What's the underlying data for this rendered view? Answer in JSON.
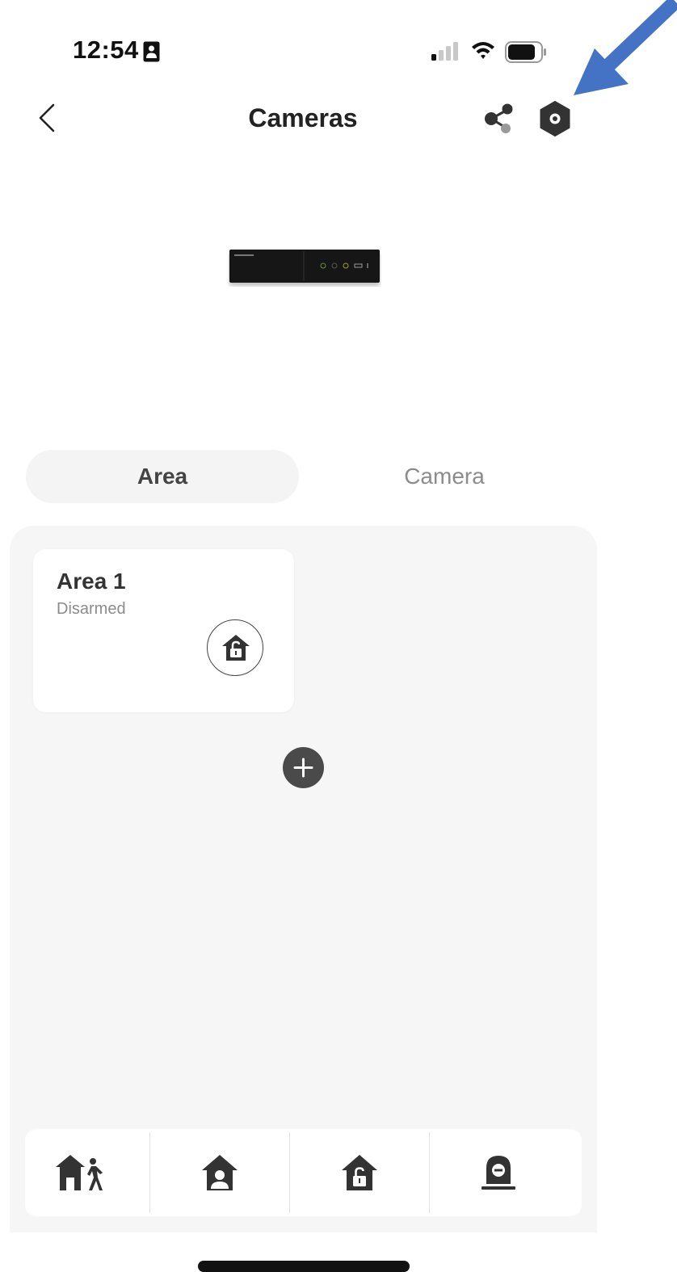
{
  "status_bar": {
    "time": "12:54",
    "sim_icon": "sim-card-icon",
    "signal_icon": "cellular-signal-icon",
    "wifi_icon": "wifi-icon",
    "battery_icon": "battery-icon"
  },
  "nav": {
    "back_icon": "chevron-left-icon",
    "title": "Cameras",
    "share_icon": "share-icon",
    "settings_icon": "settings-hexagon-icon"
  },
  "annotation": {
    "arrow_icon": "pointer-arrow-icon",
    "arrow_color": "#4472C4"
  },
  "device": {
    "image_icon": "hikvision-nvr-device-image"
  },
  "tabs": [
    {
      "label": "Area",
      "selected": true
    },
    {
      "label": "Camera",
      "selected": false
    }
  ],
  "areas": [
    {
      "name": "Area 1",
      "status": "Disarmed",
      "action_icon": "home-unlocked-icon"
    }
  ],
  "add_icon": "plus-icon",
  "action_bar": [
    {
      "icon": "away-arm-icon"
    },
    {
      "icon": "stay-arm-icon"
    },
    {
      "icon": "disarm-icon"
    },
    {
      "icon": "clear-alarm-icon"
    }
  ],
  "colors": {
    "accent_dark": "#333333",
    "tab_active_bg": "#f4f4f4",
    "panel_bg": "#f6f6f6",
    "muted_text": "#8c8c8c"
  }
}
